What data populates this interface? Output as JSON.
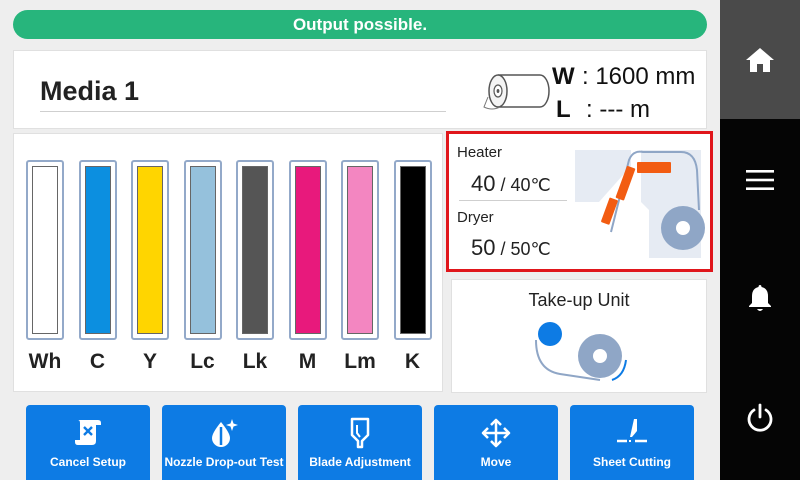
{
  "status": {
    "message": "Output possible.",
    "color": "#27b57c"
  },
  "media": {
    "name": "Media 1",
    "width_key": "W",
    "width_value": ": 1600 mm",
    "length_key": "L",
    "length_value": ": --- m",
    "icon": "media-roll-icon"
  },
  "inks": [
    {
      "label": "Wh",
      "color": "#ffffff"
    },
    {
      "label": "C",
      "color": "#0c8fe0"
    },
    {
      "label": "Y",
      "color": "#ffd500"
    },
    {
      "label": "Lc",
      "color": "#95c1dc"
    },
    {
      "label": "Lk",
      "color": "#555555"
    },
    {
      "label": "M",
      "color": "#e8197c"
    },
    {
      "label": "Lm",
      "color": "#f386c1"
    },
    {
      "label": "K",
      "color": "#000000"
    }
  ],
  "heater": {
    "heater_label": "Heater",
    "heater_current": "40",
    "heater_set": " / 40℃",
    "dryer_label": "Dryer",
    "dryer_current": "50",
    "dryer_set": " / 50℃",
    "highlight_color": "#e0161b",
    "element_color": "#f25c12"
  },
  "takeup": {
    "title": "Take-up Unit"
  },
  "buttons": [
    {
      "label": "Cancel Setup",
      "icon": "cancel-setup-icon"
    },
    {
      "label": "Nozzle Drop-out Test",
      "icon": "nozzle-test-icon"
    },
    {
      "label": "Blade Adjustment",
      "icon": "blade-icon"
    },
    {
      "label": "Move",
      "icon": "move-icon"
    },
    {
      "label": "Sheet Cutting",
      "icon": "sheet-cutting-icon"
    }
  ],
  "nav": [
    {
      "icon": "home-icon"
    },
    {
      "icon": "menu-icon"
    },
    {
      "icon": "bell-icon"
    },
    {
      "icon": "power-icon"
    }
  ],
  "colors": {
    "accent": "#0d7be4",
    "nav_bg": "#050505",
    "nav_active": "#4a4a4a"
  }
}
